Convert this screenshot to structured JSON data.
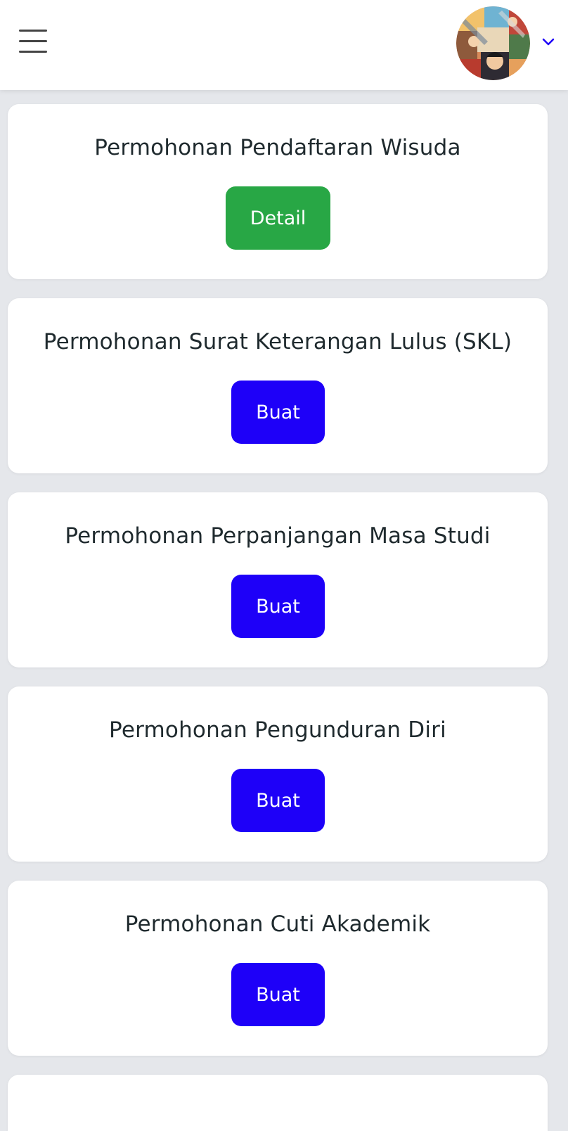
{
  "header": {
    "menu_icon": "hamburger-menu-icon",
    "avatar_icon": "user-avatar",
    "dropdown_icon": "chevron-down-icon",
    "accent_color": "#1e00f8"
  },
  "cards": [
    {
      "title": "Permohonan Pendaftaran Wisuda",
      "button": "Detail",
      "button_color": "#28a745"
    },
    {
      "title": "Permohonan Surat Keterangan Lulus (SKL)",
      "button": "Buat",
      "button_color": "#1e00f8"
    },
    {
      "title": "Permohonan Perpanjangan Masa Studi",
      "button": "Buat",
      "button_color": "#1e00f8"
    },
    {
      "title": "Permohonan Pengunduran Diri",
      "button": "Buat",
      "button_color": "#1e00f8"
    },
    {
      "title": "Permohonan Cuti Akademik",
      "button": "Buat",
      "button_color": "#1e00f8"
    }
  ]
}
